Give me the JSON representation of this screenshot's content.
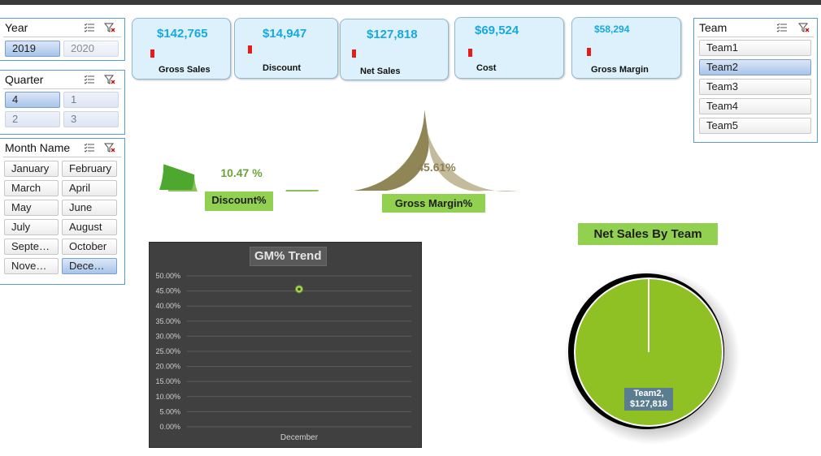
{
  "slicers": {
    "year": {
      "title": "Year",
      "items": [
        "2019",
        "2020"
      ]
    },
    "quarter": {
      "title": "Quarter",
      "items": [
        "4",
        "1",
        "2",
        "3"
      ]
    },
    "month": {
      "title": "Month Name",
      "items": [
        "January",
        "February",
        "March",
        "April",
        "May",
        "June",
        "July",
        "August",
        "Septe…",
        "October",
        "Nove…",
        "Dece…"
      ]
    },
    "team": {
      "title": "Team",
      "items": [
        "Team1",
        "Team2",
        "Team3",
        "Team4",
        "Team5"
      ]
    }
  },
  "kpis": [
    {
      "value": "$142,765",
      "label": "Gross Sales"
    },
    {
      "value": "$14,947",
      "label": "Discount"
    },
    {
      "value": "$127,818",
      "label": "Net Sales"
    },
    {
      "value": "$69,524",
      "label": "Cost"
    },
    {
      "value": "$58,294",
      "label": "Gross Margin"
    }
  ],
  "gauges": {
    "discount": {
      "value_text": "10.47 %",
      "label": "Discount%",
      "value_pct": 10.47,
      "color_fill": "#4ea72e",
      "color_rest": "#8cc05a"
    },
    "gross_margin": {
      "value_text": "45.61%",
      "label": "Gross Margin%",
      "value_pct": 45.61,
      "color_fill": "#8f8555",
      "color_rest": "#c3bb9c"
    }
  },
  "colors": {
    "accent_green": "#92d050",
    "kpi_value": "#18a8e0",
    "kpi_bg": "#dcf1fb",
    "chart_bg": "#404040",
    "pie_green": "#8fc125"
  },
  "chart_data": [
    {
      "type": "line",
      "title": "GM% Trend",
      "categories": [
        "December"
      ],
      "series": [
        {
          "values": [
            45.61
          ]
        }
      ],
      "y_ticks": [
        "50.00%",
        "45.00%",
        "40.00%",
        "35.00%",
        "30.00%",
        "25.00%",
        "20.00%",
        "15.00%",
        "10.00%",
        "5.00%",
        "0.00%"
      ],
      "ylim": [
        0,
        50
      ],
      "grid": true
    },
    {
      "type": "pie",
      "title": "Net Sales By Team",
      "slices": [
        {
          "label": "Team2",
          "value": 127818
        }
      ],
      "data_label": "Team2, $127,818"
    }
  ]
}
